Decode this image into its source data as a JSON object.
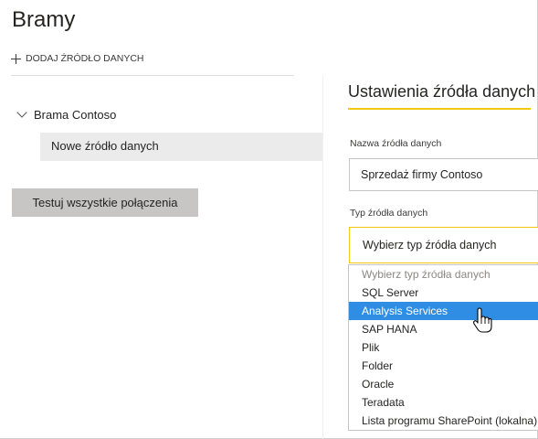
{
  "page": {
    "title": "Bramy"
  },
  "toolbar": {
    "add_datasource_label": "DODAJ ŹRÓDŁO DANYCH"
  },
  "sidebar": {
    "gateway_name": "Brama Contoso",
    "new_datasource_label": "Nowe źródło danych",
    "test_all_label": "Testuj wszystkie połączenia"
  },
  "settings": {
    "title": "Ustawienia źródła danych",
    "name_label": "Nazwa źródła danych",
    "name_value": "Sprzedaż firmy Contoso",
    "type_label": "Typ źródła danych",
    "type_selected": "Wybierz typ źródła danych",
    "options": [
      "Wybierz typ źródła danych",
      "SQL Server",
      "Analysis Services",
      "SAP HANA",
      "Plik",
      "Folder",
      "Oracle",
      "Teradata",
      "Lista programu SharePoint (lokalna)"
    ],
    "highlighted_option": "Analysis Services"
  },
  "colors": {
    "accent": "#f2c811",
    "highlight": "#2f8ee3",
    "selected_bg": "#ebebeb",
    "button_bg": "#c8c6c4"
  },
  "icons": [
    "plus-icon",
    "chevron-down-icon",
    "hand-pointer-cursor-icon"
  ]
}
